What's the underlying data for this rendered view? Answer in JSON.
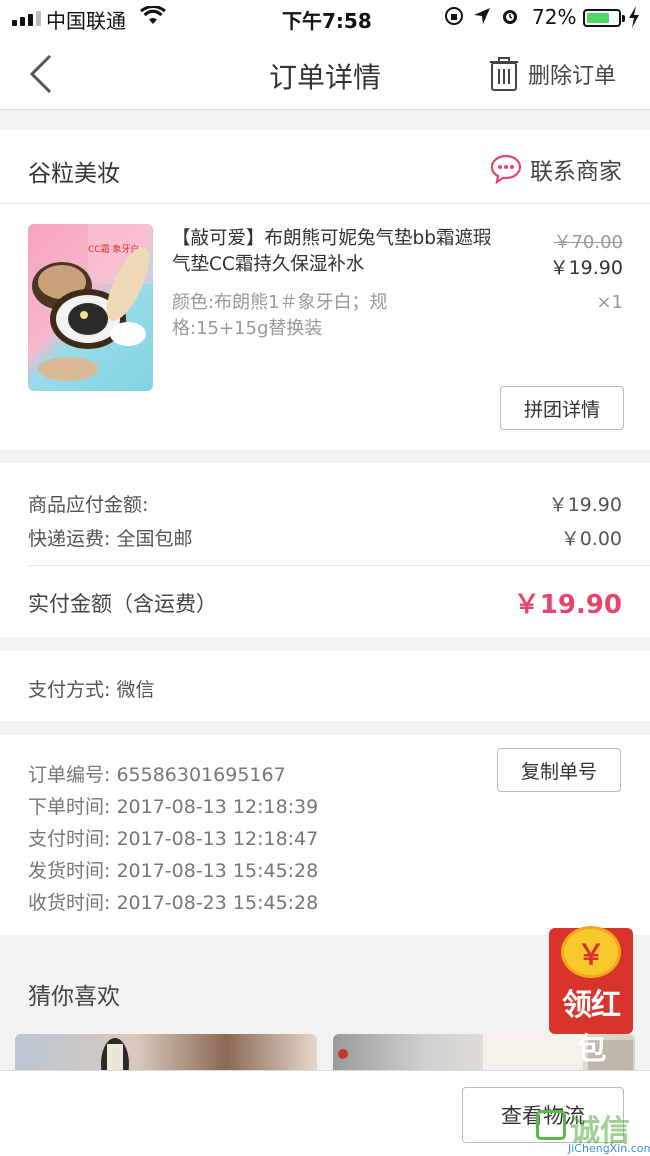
{
  "status_bar": {
    "carrier": "中国联通",
    "time": "下午7:58",
    "battery_percent": "72%",
    "battery_level": 0.72,
    "icons": [
      "signal-icon",
      "wifi-icon",
      "orientation-lock-icon",
      "location-icon",
      "alarm-icon",
      "battery-icon",
      "charging-icon"
    ]
  },
  "nav": {
    "title": "订单详情",
    "delete_label": "删除订单",
    "icons": [
      "back-chevron-icon",
      "trash-icon"
    ]
  },
  "shop": {
    "name": "谷粒美妆",
    "contact_label": "联系商家",
    "icons": [
      "chat-bubble-icon"
    ]
  },
  "product": {
    "title": "【敲可爱】布朗熊可妮兔气垫bb霜遮瑕气垫CC霜持久保湿补水",
    "original_price": "￥70.00",
    "price": "￥19.90",
    "spec": "颜色:布朗熊1＃象牙白；规格:15+15g替换装",
    "quantity": "×1",
    "image_label": "CC霜 象牙白",
    "group_button": "拼团详情"
  },
  "amounts": {
    "goods_label": "商品应付金额:",
    "goods_value": "￥19.90",
    "shipping_label": "快递运费:  全国包邮",
    "shipping_value": "￥0.00",
    "paid_label": "实付金额（含运费）",
    "paid_value": "￥19.90"
  },
  "payment": {
    "method_label": "支付方式:  微信"
  },
  "order_info": {
    "order_no_label": "订单编号:  65586301695167",
    "copy_button": "复制单号",
    "placed_label": "下单时间:  2017-08-13  12:18:39",
    "paid_label": "支付时间:  2017-08-13  12:18:47",
    "shipped_label": "发货时间:  2017-08-13  15:45:28",
    "received_label": "收货时间:  2017-08-23  15:45:28"
  },
  "recommend": {
    "title": "猜你喜欢"
  },
  "red_packet": {
    "coin": "￥",
    "label": "领红包"
  },
  "bottom": {
    "logistics_button": "查看物流"
  },
  "watermark": {
    "cn": "诚信",
    "en": "JiChengXin.com"
  },
  "colors": {
    "accent": "#e8456c",
    "red_packet": "#d9342b",
    "background": "#f2f2f2"
  }
}
